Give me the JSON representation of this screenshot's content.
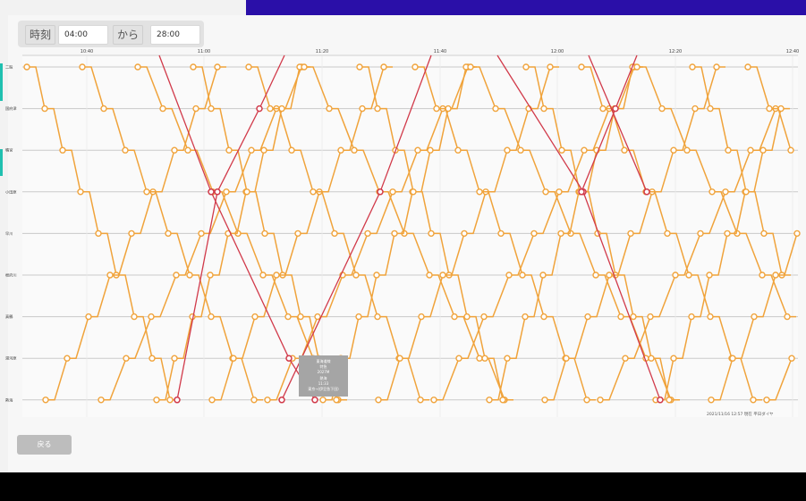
{
  "filter": {
    "time_label": "時刻",
    "time_from": "04:00",
    "from_label": "から",
    "time_to": "28:00"
  },
  "time_axis": [
    "10:40",
    "11:00",
    "11:20",
    "11:40",
    "12:00",
    "12:20",
    "12:40"
  ],
  "stations": [
    "二股",
    "国府津",
    "鴨宮",
    "小田原",
    "早川",
    "根府川",
    "真鶴",
    "湯河原",
    "熱海"
  ],
  "tooltip": [
    "東海道線",
    "特急",
    "2027M",
    "熱海",
    "11:33",
    "東京→(伊豆急下田)"
  ],
  "footer_stamp": "2021/11/16 12:57 現在 平日ダイヤ",
  "back_label": "戻る",
  "colors": {
    "local": "#f0a33b",
    "express": "#d13a4a",
    "header": "#2a0fa8"
  }
}
